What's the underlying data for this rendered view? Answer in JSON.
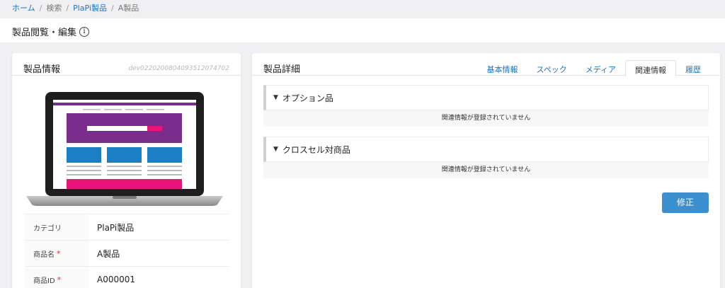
{
  "breadcrumb": {
    "home": "ホーム",
    "search": "検索",
    "category": "PlaPi製品",
    "current": "A製品"
  },
  "page": {
    "title": "製品閲覧・編集"
  },
  "left": {
    "title": "製品情報",
    "device_id": "dev022020080409351207470​2",
    "rows": [
      {
        "label": "カテゴリ",
        "required": false,
        "value": "PlaPi製品"
      },
      {
        "label": "商品名",
        "required": true,
        "value": "A製品"
      },
      {
        "label": "商品ID",
        "required": true,
        "value": "A000001"
      }
    ]
  },
  "right": {
    "title": "製品詳細",
    "tabs": [
      {
        "label": "基本情報",
        "active": false
      },
      {
        "label": "スペック",
        "active": false
      },
      {
        "label": "メディア",
        "active": false
      },
      {
        "label": "関連情報",
        "active": true
      },
      {
        "label": "履歴",
        "active": false
      }
    ],
    "sections": [
      {
        "title": "オプション品",
        "empty_text": "関連情報が登録されていません"
      },
      {
        "title": "クロスセル対商品",
        "empty_text": "関連情報が登録されていません"
      }
    ],
    "edit_label": "修正"
  },
  "colors": {
    "link": "#1a73c8",
    "button": "#3b8fcf",
    "required": "#e23"
  }
}
